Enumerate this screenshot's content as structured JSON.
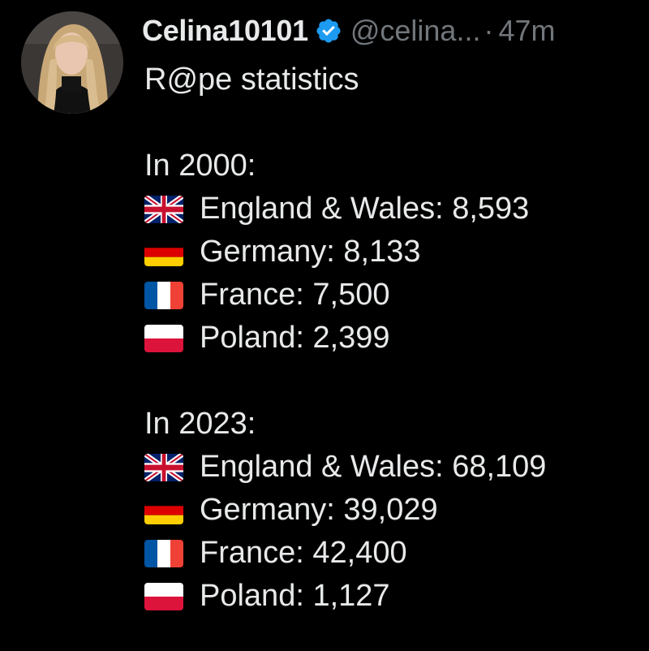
{
  "tweet": {
    "author": {
      "display_name": "Celina10101",
      "handle": "@celina...",
      "verified_icon": "verified-badge-icon",
      "avatar": "profile-photo"
    },
    "separator": "·",
    "timestamp": "47m",
    "text": {
      "title": "R@pe statistics",
      "sections": [
        {
          "heading": "In 2000:",
          "rows": [
            {
              "flag": "uk-flag-icon",
              "country": "England & Wales",
              "value": "8,593"
            },
            {
              "flag": "germany-flag-icon",
              "country": "Germany",
              "value": "8,133"
            },
            {
              "flag": "france-flag-icon",
              "country": "France",
              "value": "7,500"
            },
            {
              "flag": "poland-flag-icon",
              "country": "Poland",
              "value": "2,399"
            }
          ]
        },
        {
          "heading": "In 2023:",
          "rows": [
            {
              "flag": "uk-flag-icon",
              "country": "England & Wales",
              "value": "68,109"
            },
            {
              "flag": "germany-flag-icon",
              "country": "Germany",
              "value": "39,029"
            },
            {
              "flag": "france-flag-icon",
              "country": "France",
              "value": "42,400"
            },
            {
              "flag": "poland-flag-icon",
              "country": "Poland",
              "value": "1,127"
            }
          ]
        }
      ]
    }
  },
  "colors": {
    "background": "#000000",
    "primary_text": "#e7e9ea",
    "secondary_text": "#71767b",
    "verified_blue": "#1d9bf0"
  }
}
